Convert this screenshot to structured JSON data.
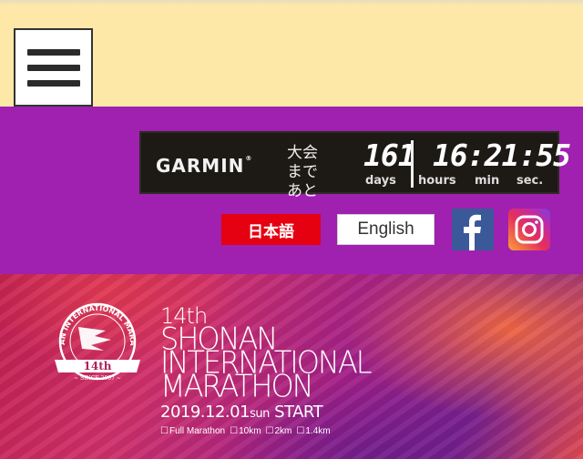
{
  "header": {
    "menu_icon": "hamburger-menu-icon"
  },
  "countdown": {
    "sponsor": "GARMIN",
    "label_line1": "大会まで",
    "label_line2": "あと",
    "days": "161",
    "hours": "16",
    "minutes": "21",
    "seconds": "55",
    "time_display": "16:21:55",
    "unit_days": "days",
    "unit_hours": "hours",
    "unit_min": "min",
    "unit_sec": "sec."
  },
  "languages": {
    "japanese": "日本語",
    "english": "English"
  },
  "social": {
    "facebook_icon": "facebook-icon",
    "instagram_icon": "instagram-icon"
  },
  "hero": {
    "emblem_ring_text": "SHONAN INTERNATIONAL MARATHON",
    "emblem_edition": "14th",
    "emblem_since": "~ SINCE 2007 ~",
    "edition": "14th",
    "title_line1": "SHONAN",
    "title_line2": "INTERNATIONAL",
    "title_line3": "MARATHON",
    "date": "2019.12.01",
    "weekday": "sun",
    "start": "START",
    "courses": [
      "Full Marathon",
      "10km",
      "2km",
      "1.4km"
    ]
  },
  "colors": {
    "header_bg": "#fde8a8",
    "purple_bar": "#a020b0",
    "japanese_button": "#e50012",
    "facebook": "#3b5998"
  }
}
